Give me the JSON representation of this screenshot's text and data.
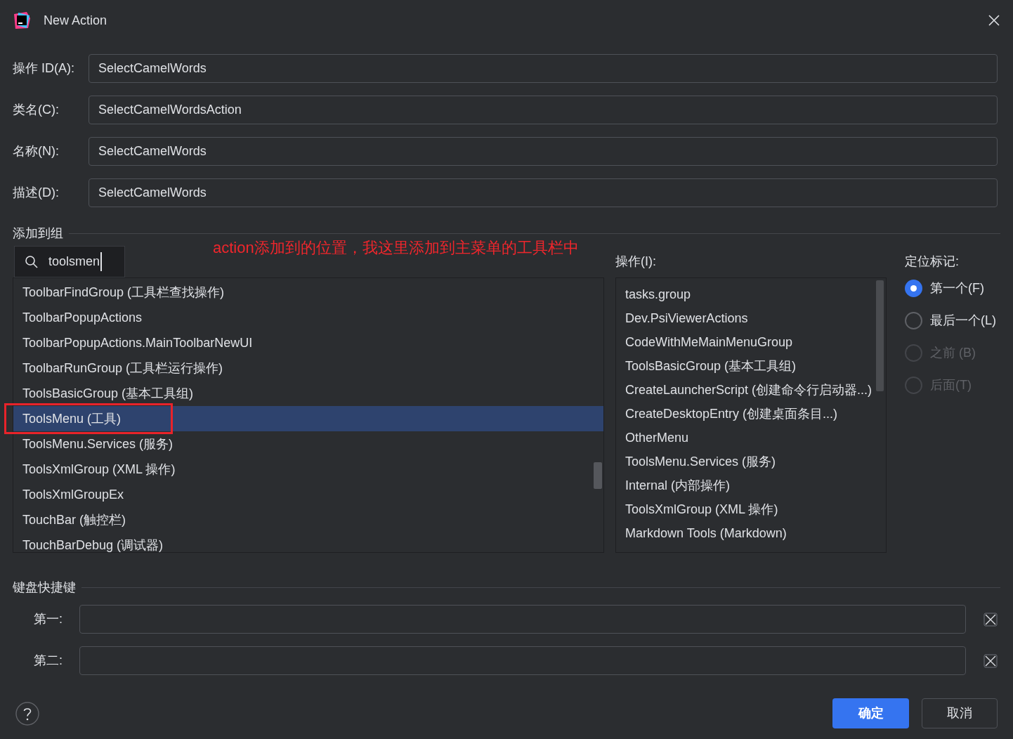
{
  "window": {
    "title": "New Action"
  },
  "fields": [
    {
      "label": "操作 ID(A):",
      "value": "SelectCamelWords"
    },
    {
      "label": "类名(C):",
      "value": "SelectCamelWordsAction"
    },
    {
      "label": "名称(N):",
      "value": "SelectCamelWords"
    },
    {
      "label": "描述(D):",
      "value": "SelectCamelWords"
    }
  ],
  "group_section": {
    "title": "添加到组",
    "annotation": "action添加到的位置，我这里添加到主菜单的工具栏中",
    "search": {
      "value": "toolsmen"
    },
    "groups": [
      {
        "label": "ToolbarFindGroup (工具栏查找操作)",
        "selected": false
      },
      {
        "label": "ToolbarPopupActions",
        "selected": false
      },
      {
        "label": "ToolbarPopupActions.MainToolbarNewUI",
        "selected": false
      },
      {
        "label": "ToolbarRunGroup (工具栏运行操作)",
        "selected": false
      },
      {
        "label": "ToolsBasicGroup (基本工具组)",
        "selected": false
      },
      {
        "label": "ToolsMenu (工具)",
        "selected": true,
        "annotated": true
      },
      {
        "label": "ToolsMenu.Services (服务)",
        "selected": false
      },
      {
        "label": "ToolsXmlGroup (XML 操作)",
        "selected": false
      },
      {
        "label": "ToolsXmlGroupEx",
        "selected": false
      },
      {
        "label": "TouchBar (触控栏)",
        "selected": false
      },
      {
        "label": "TouchBarDebug (调试器)",
        "selected": false
      }
    ],
    "actions_label": "操作(I):",
    "actions": [
      "tasks.group",
      "Dev.PsiViewerActions",
      "CodeWithMeMainMenuGroup",
      "ToolsBasicGroup (基本工具组)",
      "CreateLauncherScript (创建命令行启动器...)",
      "CreateDesktopEntry (创建桌面条目...)",
      "OtherMenu",
      "ToolsMenu.Services (服务)",
      "Internal (内部操作)",
      "ToolsXmlGroup (XML 操作)",
      "Markdown Tools (Markdown)"
    ],
    "anchor_label": "定位标记:",
    "anchors": [
      {
        "label": "第一个(F)",
        "selected": true,
        "disabled": false
      },
      {
        "label": "最后一个(L)",
        "selected": false,
        "disabled": false
      },
      {
        "label": "之前 (B)",
        "selected": false,
        "disabled": true
      },
      {
        "label": "后面(T)",
        "selected": false,
        "disabled": true
      }
    ]
  },
  "shortcut_section": {
    "title": "键盘快捷键",
    "rows": [
      {
        "label": "第一:"
      },
      {
        "label": "第二:"
      }
    ]
  },
  "buttons": {
    "ok": "确定",
    "cancel": "取消"
  }
}
